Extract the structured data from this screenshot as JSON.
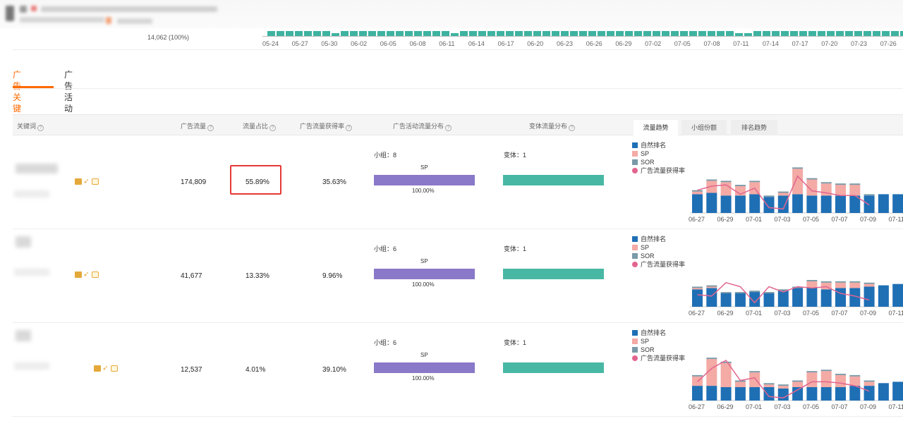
{
  "colors": {
    "accent": "#ff6a00",
    "organic": "#1f6fb5",
    "sp": "#f4aaa5",
    "sor": "#7a9aa8",
    "share_line": "#e2658f",
    "sp_bar": "#8a78c8",
    "variant_bar": "#48b8a4",
    "highlight": "#e53935"
  },
  "timeline": {
    "total_label": "14,062 (100%)",
    "dates": [
      "05-24",
      "05-27",
      "05-30",
      "06-02",
      "06-05",
      "06-08",
      "06-11",
      "06-14",
      "06-17",
      "06-20",
      "06-23",
      "06-26",
      "06-29",
      "07-02",
      "07-05",
      "07-08",
      "07-11",
      "07-14",
      "07-17",
      "07-20",
      "07-23",
      "07-26"
    ]
  },
  "tabs": [
    {
      "label": "广告关键词",
      "active": true
    },
    {
      "label": "广告活动",
      "active": false
    }
  ],
  "table": {
    "headers": {
      "keyword": "关键词",
      "ad_traffic": "广告流量",
      "traffic_share": "流量占比",
      "ad_share_rate": "广告流量获得率",
      "campaign_dist": "广告活动流量分布",
      "variant_dist": "变体流量分布"
    },
    "help_icon": "question-circle-icon",
    "chart_tabs": [
      {
        "label": "流量趋势",
        "active": true
      },
      {
        "label": "小组份额",
        "active": false
      },
      {
        "label": "排名趋势",
        "active": false
      }
    ],
    "rows": [
      {
        "ad_traffic": "174,809",
        "traffic_share": "55.89%",
        "ad_share_rate": "35.63%",
        "group_label": "小组：",
        "group_count": "8",
        "sp_label": "SP",
        "sp_pct": "100.00%",
        "variant_label": "变体：",
        "variant_count": "1",
        "highlighted": true
      },
      {
        "ad_traffic": "41,677",
        "traffic_share": "13.33%",
        "ad_share_rate": "9.96%",
        "group_label": "小组：",
        "group_count": "6",
        "sp_label": "SP",
        "sp_pct": "100.00%",
        "variant_label": "变体：",
        "variant_count": "1",
        "highlighted": false
      },
      {
        "ad_traffic": "12,537",
        "traffic_share": "4.01%",
        "ad_share_rate": "39.10%",
        "group_label": "小组：",
        "group_count": "6",
        "sp_label": "SP",
        "sp_pct": "100.00%",
        "variant_label": "变体：",
        "variant_count": "1",
        "highlighted": false
      }
    ]
  },
  "legend": [
    {
      "label": "自然排名",
      "kind": "square",
      "color_key": "organic"
    },
    {
      "label": "SP",
      "kind": "square",
      "color_key": "sp"
    },
    {
      "label": "SOR",
      "kind": "square",
      "color_key": "sor"
    },
    {
      "label": "广告流量获得率",
      "kind": "dot",
      "color_key": "share_line"
    }
  ],
  "chart_data": [
    {
      "type": "bar",
      "x_ticks": [
        "06-27",
        "06-29",
        "07-01",
        "07-03",
        "07-05",
        "07-07",
        "07-09",
        "07-11"
      ],
      "series": [
        {
          "name": "自然排名",
          "values": [
            28,
            30,
            26,
            26,
            28,
            24,
            26,
            28,
            26,
            26,
            26,
            26,
            26,
            28,
            28
          ]
        },
        {
          "name": "SP",
          "values": [
            4,
            18,
            20,
            14,
            18,
            0,
            4,
            38,
            24,
            18,
            16,
            16,
            0,
            0,
            0
          ]
        },
        {
          "name": "SOR",
          "values": [
            1,
            1,
            1,
            1,
            1,
            1,
            1,
            1,
            1,
            1,
            1,
            1,
            1,
            0,
            0
          ]
        },
        {
          "name": "广告流量获得率",
          "values": [
            34,
            40,
            42,
            28,
            37,
            8,
            6,
            55,
            33,
            30,
            26,
            26,
            12,
            null,
            null
          ]
        }
      ]
    },
    {
      "type": "bar",
      "x_ticks": [
        "06-27",
        "06-29",
        "07-01",
        "07-03",
        "07-05",
        "07-07",
        "07-09",
        "07-11"
      ],
      "series": [
        {
          "name": "自然排名",
          "values": [
            26,
            28,
            20,
            20,
            22,
            20,
            24,
            28,
            28,
            26,
            28,
            28,
            30,
            32,
            34
          ]
        },
        {
          "name": "SP",
          "values": [
            2,
            2,
            0,
            0,
            0,
            0,
            0,
            0,
            10,
            10,
            8,
            8,
            4,
            0,
            0
          ]
        },
        {
          "name": "SOR",
          "values": [
            1,
            1,
            1,
            1,
            1,
            1,
            1,
            1,
            1,
            1,
            1,
            1,
            1,
            0,
            0
          ]
        },
        {
          "name": "广告流量获得率",
          "values": [
            18,
            16,
            36,
            30,
            6,
            30,
            22,
            30,
            28,
            30,
            20,
            16,
            10,
            null,
            null
          ]
        }
      ]
    },
    {
      "type": "bar",
      "x_ticks": [
        "06-27",
        "06-29",
        "07-01",
        "07-03",
        "07-05",
        "07-07",
        "07-09",
        "07-11"
      ],
      "series": [
        {
          "name": "自然排名",
          "values": [
            22,
            22,
            20,
            20,
            20,
            20,
            18,
            20,
            20,
            20,
            20,
            22,
            22,
            26,
            28
          ]
        },
        {
          "name": "SP",
          "values": [
            14,
            40,
            36,
            8,
            22,
            4,
            4,
            8,
            22,
            24,
            18,
            14,
            6,
            0,
            0
          ]
        },
        {
          "name": "SOR",
          "values": [
            1,
            1,
            1,
            1,
            1,
            1,
            1,
            1,
            1,
            1,
            1,
            1,
            1,
            0,
            0
          ]
        },
        {
          "name": "广告流量获得率",
          "values": [
            28,
            48,
            60,
            30,
            34,
            6,
            4,
            16,
            28,
            28,
            26,
            22,
            14,
            null,
            null
          ]
        }
      ]
    }
  ]
}
